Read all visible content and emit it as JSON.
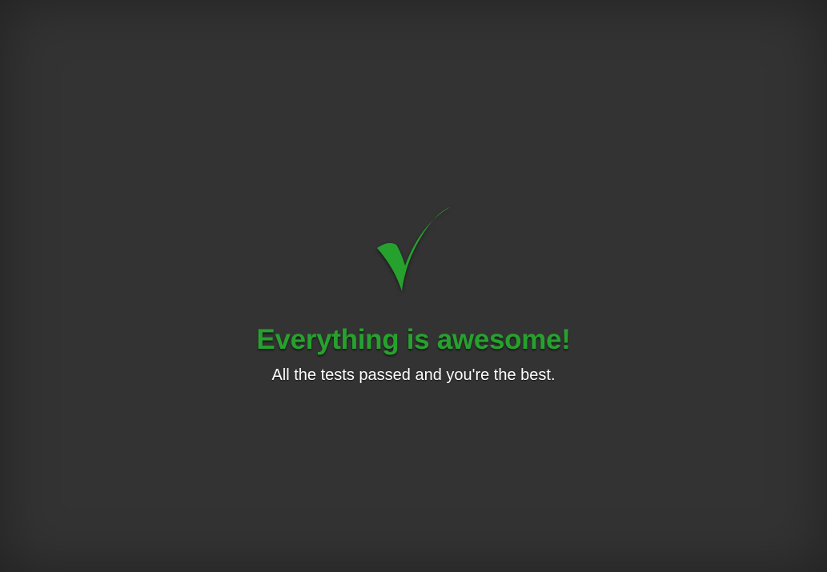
{
  "status": {
    "icon": "check-icon",
    "title": "Everything is awesome!",
    "message": "All the tests passed and you're the best.",
    "accent_color": "#27a12e",
    "background_color": "#333333",
    "message_color": "#ffffff"
  }
}
